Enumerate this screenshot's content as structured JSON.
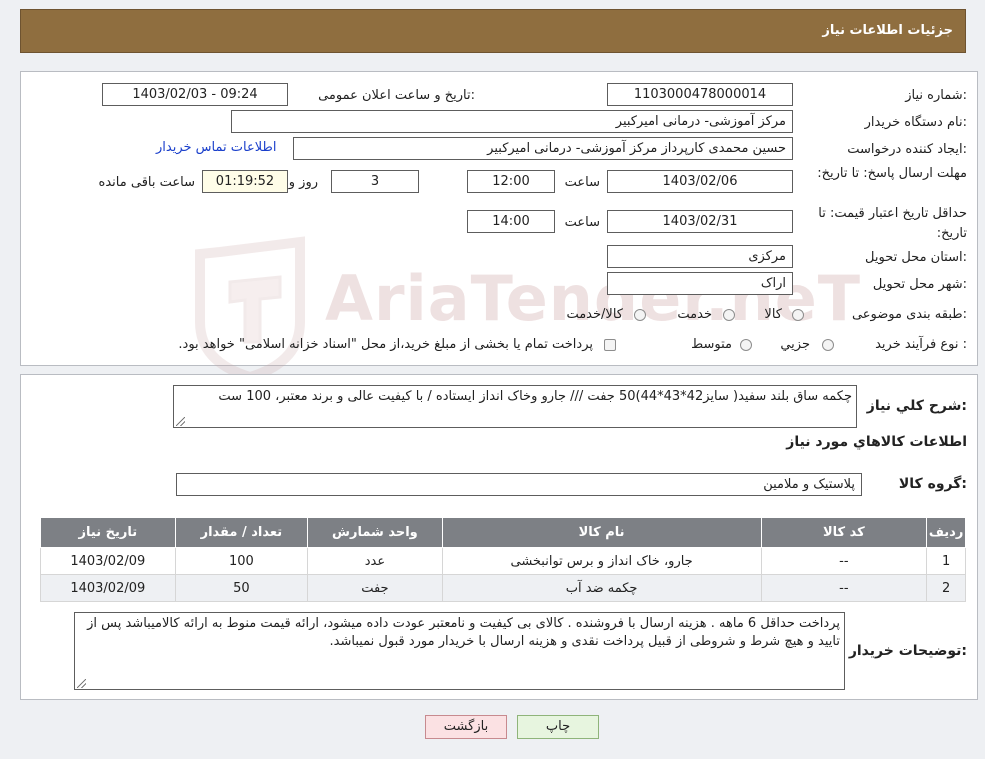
{
  "page": {
    "header_title": "جزئیات اطلاعات نیاز",
    "watermark_text": "AriaTender.neT"
  },
  "form": {
    "need_number_label": "شماره نیاز:",
    "need_number": "1103000478000014",
    "announce_label": "تاریخ و ساعت اعلان عمومی:",
    "announce_value": "1403/02/03 - 09:24",
    "buyer_org_label": "نام دستگاه خریدار:",
    "buyer_org": "مرکز آموزشی- درمانی امیرکبیر",
    "creator_label": "ایجاد کننده درخواست:",
    "creator": "حسین  محمدی کارپرداز مرکز آموزشی- درمانی امیرکبیر",
    "contact_link": "اطلاعات تماس خریدار",
    "deadline_label": "مهلت ارسال پاسخ: تا تاریخ:",
    "deadline_date": "1403/02/06",
    "time_label": "ساعت",
    "deadline_time": "12:00",
    "days_value": "3",
    "days_label": "روز و",
    "remaining_time": "01:19:52",
    "remaining_label": "ساعت باقی مانده",
    "validity_label": "حداقل تاریخ اعتبار قیمت: تا تاریخ:",
    "validity_date": "1403/02/31",
    "validity_time": "14:00",
    "province_label": "استان محل تحویل:",
    "province": "مرکزی",
    "city_label": "شهر محل تحویل:",
    "city": "اراک",
    "category_label": "طبقه بندی موضوعی:",
    "category_options": [
      "کالا",
      "خدمت",
      "کالا/خدمت"
    ],
    "process_label": "نوع فرآیند خرید :",
    "process_options": [
      "جزیي",
      "متوسط"
    ],
    "process_note": "پرداخت تمام یا بخشی از مبلغ خرید،از محل \"اسناد خزانه اسلامی\" خواهد بود."
  },
  "summary": {
    "desc_label": "شرح کلي نياز:",
    "desc_text": "چکمه ساق بلند سفید( سایز42*43*44)50 جفت /// جارو وخاک انداز ایستاده / با کیفیت عالی و برند معتبر، 100 ست",
    "items_title": "اطلاعات کالاهاي مورد نياز",
    "group_label": "گروه کالا:",
    "group_value": "پلاستیک و ملامین"
  },
  "table": {
    "headers": [
      "ردیف",
      "کد کالا",
      "نام کالا",
      "واحد شمارش",
      "تعداد / مقدار",
      "تاریخ نیاز"
    ],
    "rows": [
      [
        "1",
        "--",
        "جارو، خاک انداز و برس توانبخشی",
        "عدد",
        "100",
        "1403/02/09"
      ],
      [
        "2",
        "--",
        "چکمه ضد آب",
        "جفت",
        "50",
        "1403/02/09"
      ]
    ]
  },
  "notes": {
    "label": "توضیحات خریدار:",
    "text": "پرداخت حداقل 6 ماهه . هزینه ارسال با فروشنده .  کالای بی کیفیت و نامعتبر عودت داده میشود، ارائه قیمت منوط به ارائه کالامیباشد پس از تایید و هیچ شرط و شروطی از قبیل پرداخت نقدی و هزینه ارسال با خریدار مورد قبول نمیباشد."
  },
  "buttons": {
    "print": "چاپ",
    "back": "بازگشت"
  },
  "colors": {
    "header_bg": "#8f6e3f",
    "table_header_bg": "#7d8085",
    "link": "#1a3fcb"
  }
}
